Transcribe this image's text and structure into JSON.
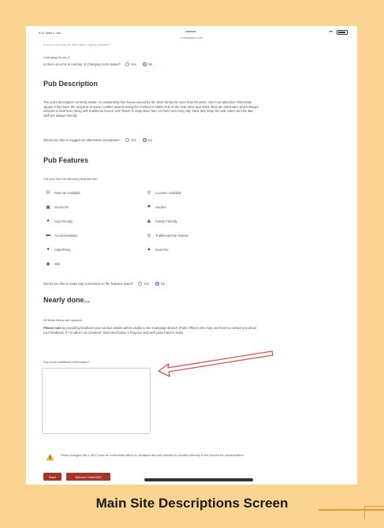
{
  "status_bar": {
    "time": "9:41 Wed 1 Jan",
    "host": "s.netspace.com"
  },
  "top": {
    "cut_line": "Is there an entry for alternative regular features?",
    "changing_room_label": "Changing Room: 6",
    "changing_question": "Is there an error in number of changing room stated?",
    "yes": "Yes",
    "no": "No"
  },
  "description": {
    "heading": "Pub Description",
    "body": "The pub's description currently reads: An outstanding free house owned by the Stein family for more than 60 years. Set in an attractive Thameside square it has been the recipient of many CAMRA awards being the Fenland CAMRA Pub of the Year 2014 and 2015. Real ale dominates which always includes a local beer along with traditional Gueen and Pilsner to keep Bass fans on their toes every day. Next they keep 60 cask ciders and the Bar staff are always friendly.",
    "question": "Would you like to suggest an alternative description?",
    "yes": "Yes",
    "no": "No"
  },
  "features": {
    "heading": "Pub Features",
    "intro": "The pub has the following features set:",
    "items": [
      {
        "label": "Real Ale Available",
        "icon": "pint-icon"
      },
      {
        "label": "Lunches Available",
        "icon": "cutlery-icon"
      },
      {
        "label": "Good Fire",
        "icon": "fire-icon"
      },
      {
        "label": "Garden",
        "icon": "tree-icon"
      },
      {
        "label": "Dog Friendly",
        "icon": "paw-icon"
      },
      {
        "label": "Family Friendly",
        "icon": "family-icon"
      },
      {
        "label": "Accommodation",
        "icon": "bed-icon"
      },
      {
        "label": "Traditional Pub Games",
        "icon": "darts-icon"
      },
      {
        "label": "Cider/Perry",
        "icon": "apple-icon"
      },
      {
        "label": "Real Fire",
        "icon": "flame-icon"
      },
      {
        "label": "Wifi",
        "icon": "wifi-icon"
      }
    ],
    "question": "Would you like to make any corrections to the features listed?",
    "yes": "Yes",
    "no": "No"
  },
  "nearly_done": {
    "heading": "Nearly done...",
    "line1": "All fields below are optional.",
    "please_note_bold": "Please note",
    "please_note_rest": " by providing feedback your contact details will be visible to the Campaign Branch (Pubs Officer) who may use them to contact you about your feedback. If 'I'd rather not comment' Total Ales/Ciders 2 Propose and we'll pass Patch's fields.",
    "additional_label": "Any more additional information?"
  },
  "warning": {
    "text": "These changes WILL NOT have an immediate effect on whatpub and will instead be emailed directly to the branch for consideration."
  },
  "buttons": {
    "back": "Back",
    "submit": "Submit CHANGES"
  },
  "caption": "Main Site Descriptions Screen",
  "colors": {
    "background": "#fbd492",
    "accent_button": "#a93226",
    "radio_selected": "#2f6fe0",
    "arrow": "#e05050"
  }
}
